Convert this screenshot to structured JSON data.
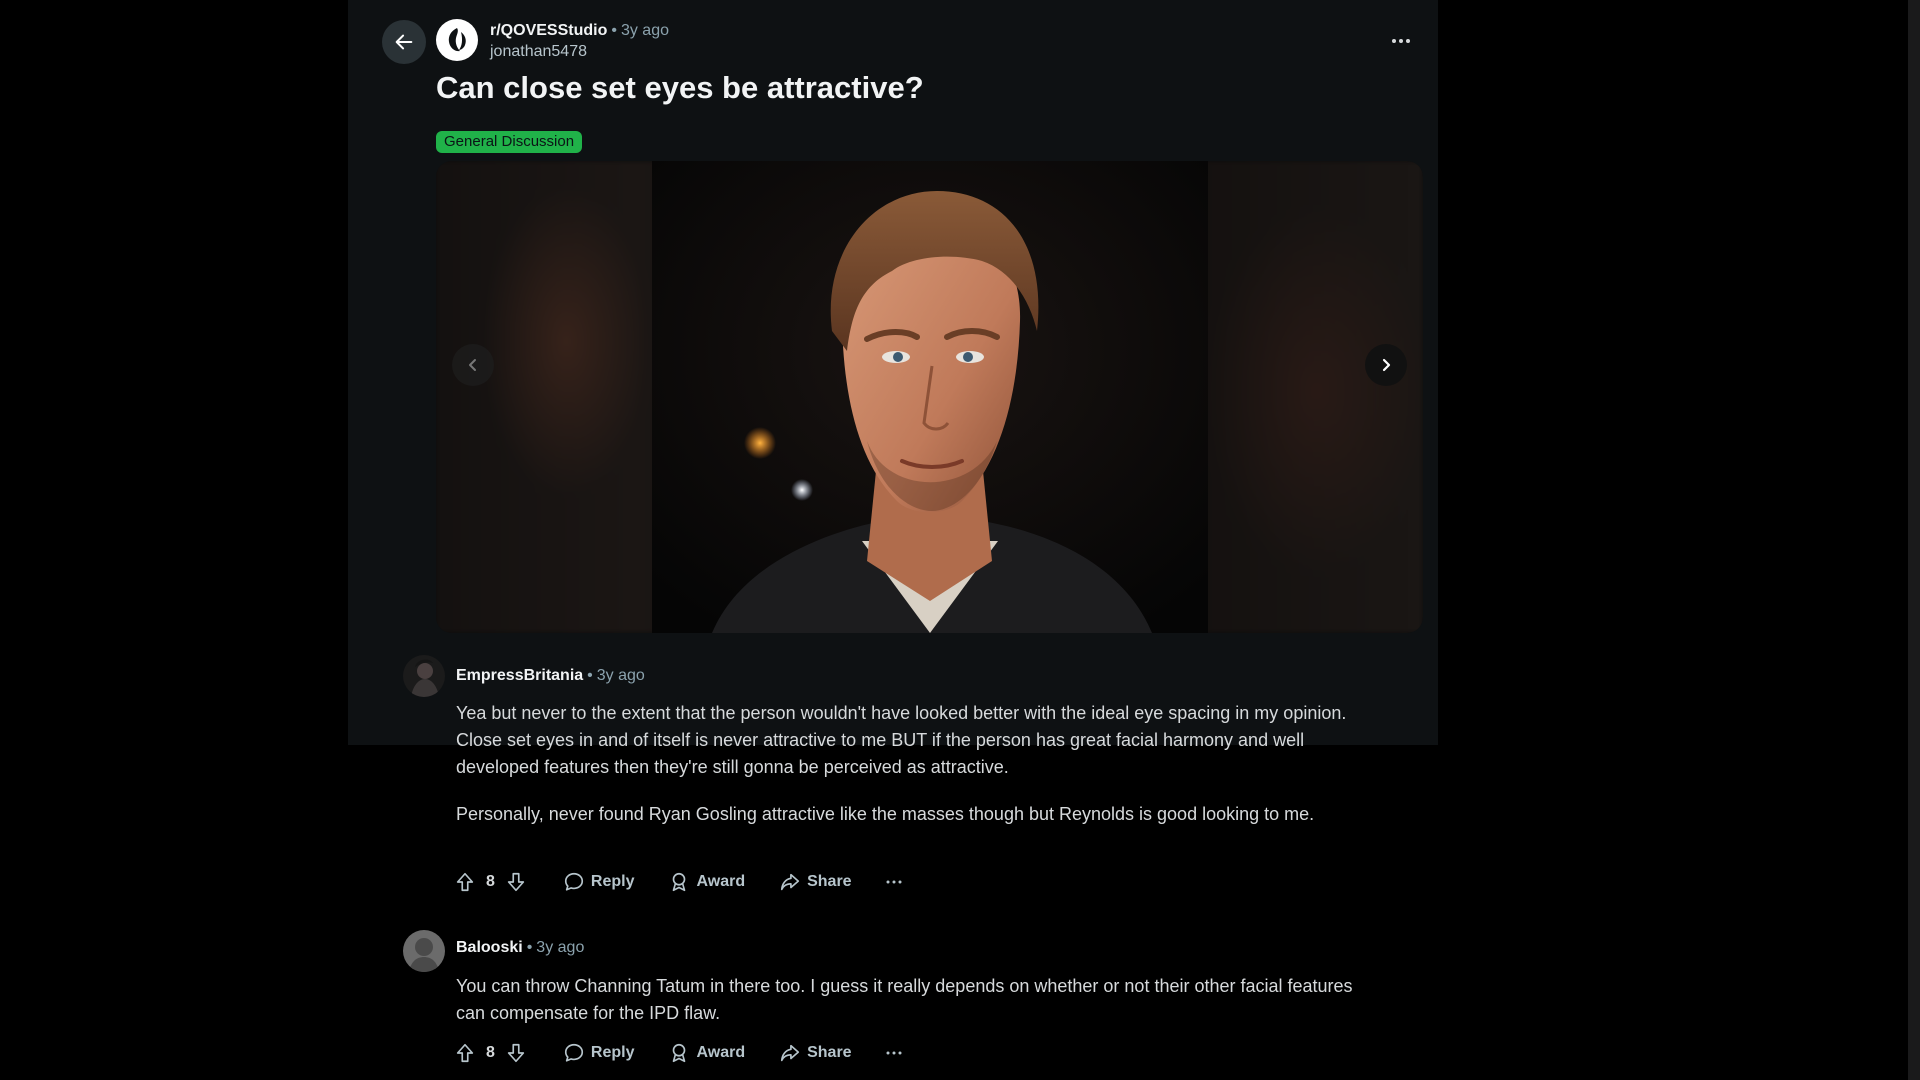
{
  "post": {
    "subreddit": "r/QOVESStudio",
    "time": "3y ago",
    "author": "jonathan5478",
    "title": "Can close set eyes be attractive?",
    "flair": "General Discussion",
    "flair_color": "#20b249"
  },
  "icons": {
    "back": "arrow-left-icon",
    "more": "more-horizontal-icon",
    "subreddit_avatar": "subreddit-logo-icon",
    "gallery_prev": "chevron-left-icon",
    "gallery_next": "chevron-right-icon",
    "upvote": "arrow-up-icon",
    "downvote": "arrow-down-icon",
    "reply": "speech-bubble-icon",
    "award": "award-icon",
    "share": "share-arrow-icon",
    "comment_more": "ellipsis-icon"
  },
  "comments": [
    {
      "author": "EmpressBritania",
      "time": "3y ago",
      "paragraphs": [
        "Yea but never to the extent that the person wouldn't have looked better with the ideal eye spacing in my opinion. Close set eyes in and of itself is never attractive to me BUT if the person has great facial harmony and well developed features then they're still gonna be perceived as attractive.",
        "Personally, never found Ryan Gosling attractive like the masses though but Reynolds is good looking to me."
      ],
      "votes": "8",
      "reply_label": "Reply",
      "award_label": "Award",
      "share_label": "Share"
    },
    {
      "author": "Balooski",
      "time": "3y ago",
      "paragraphs": [
        "You can throw Channing Tatum in there too. I guess it really depends on whether or not their other facial features can compensate for the IPD flaw."
      ],
      "votes": "8",
      "reply_label": "Reply",
      "award_label": "Award",
      "share_label": "Share"
    }
  ],
  "colors": {
    "page_bg": "#000000",
    "card_bg": "#0e1113",
    "text_primary": "#f2f4f5",
    "text_secondary": "#8ba2ad"
  }
}
